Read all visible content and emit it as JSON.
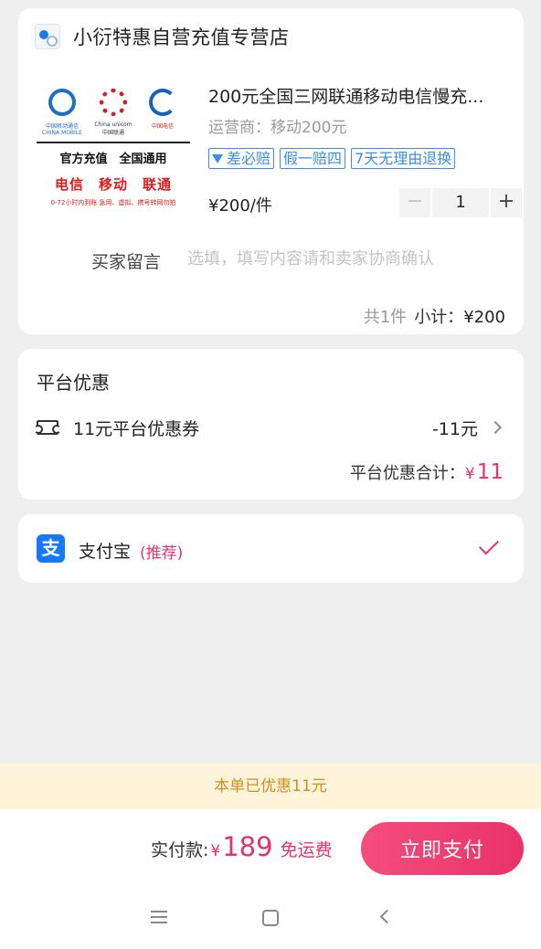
{
  "store": {
    "name": "小衍特惠自营充值专营店"
  },
  "product": {
    "title": "200元全国三网联通移动电信慢充...",
    "spec": "运营商：移动200元",
    "tags": [
      "差必赔",
      "假一赔四",
      "7天无理由退换"
    ],
    "price": "¥200/件",
    "quantity": "1",
    "image": {
      "logo_captions": [
        "中国移动通信 CHINA MOBILE",
        "China unicom 中国联通",
        "中国电信"
      ],
      "line1": "官方充值　全国通用",
      "line2": "电信　移动　联通",
      "line3": "0-72小时内到账 急用、虚拟、携号转网勿拍"
    }
  },
  "message": {
    "label": "买家留言",
    "placeholder": "选填，填写内容请和卖家协商确认"
  },
  "subtotal": {
    "count": "共1件",
    "label": "小计：",
    "amount": "¥200"
  },
  "coupon": {
    "section_title": "平台优惠",
    "name": "11元平台优惠券",
    "amount": "-11元",
    "total_label": "平台优惠合计：",
    "total_currency": "¥",
    "total_value": "11"
  },
  "payment": {
    "method": "支付宝",
    "recommend": "(推荐)",
    "icon_char": "支"
  },
  "saving_notice": "本单已优惠11元",
  "checkout": {
    "label": "实付款:",
    "currency": "¥",
    "amount": "189",
    "shipping": "免运费",
    "button": "立即支付"
  },
  "colors": {
    "accent": "#e8336a",
    "tag_blue": "#3e8ce6",
    "saving_bg": "#fdf4d9",
    "saving_text": "#d08d22",
    "alipay_blue": "#1677ff"
  },
  "icons": {
    "store_logo": "store-logo-icon",
    "tag_badge": "diamond-icon",
    "coupon": "ticket-icon",
    "chevron": "chevron-right-icon",
    "check": "check-icon",
    "nav": [
      "menu-icon",
      "home-icon",
      "back-icon"
    ]
  }
}
